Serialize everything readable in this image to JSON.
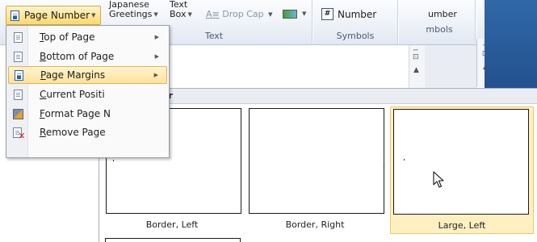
{
  "ribbon": {
    "page_number_label": "Page Number",
    "japanese_greetings": [
      "Japanese",
      "Greetings"
    ],
    "text_box": [
      "Text",
      "Box"
    ],
    "drop_cap_label": "Drop Cap",
    "text_group_label": "Text",
    "number_label": "Number",
    "symbols_group_label": "Symbols",
    "partial_number_label": "umber",
    "partial_symbols_label": "mbols"
  },
  "menu": {
    "items": [
      {
        "label": "Top of Page",
        "icon": "page-top-icon",
        "submenu": true
      },
      {
        "label": "Bottom of Page",
        "icon": "page-bottom-icon",
        "submenu": true
      },
      {
        "label": "Page Margins",
        "icon": "page-margins-icon",
        "submenu": true,
        "highlighted": true
      },
      {
        "label": "Current Positi",
        "icon": "current-position-icon",
        "submenu": false
      },
      {
        "label": "Format Page N",
        "icon": "format-page-numbers-icon",
        "submenu": false
      },
      {
        "label": "Remove Page",
        "icon": "remove-page-numbers-icon",
        "submenu": false
      }
    ]
  },
  "gallery": {
    "header": "Plain Number",
    "items": [
      {
        "caption": "Border, Left",
        "selected": false
      },
      {
        "caption": "Border, Right",
        "selected": false
      },
      {
        "caption": "Large, Left",
        "selected": true
      }
    ]
  },
  "colors": {
    "highlight": "#ffe29a",
    "selection_border": "#f0c662",
    "ribbon_dark": "#24518e"
  }
}
